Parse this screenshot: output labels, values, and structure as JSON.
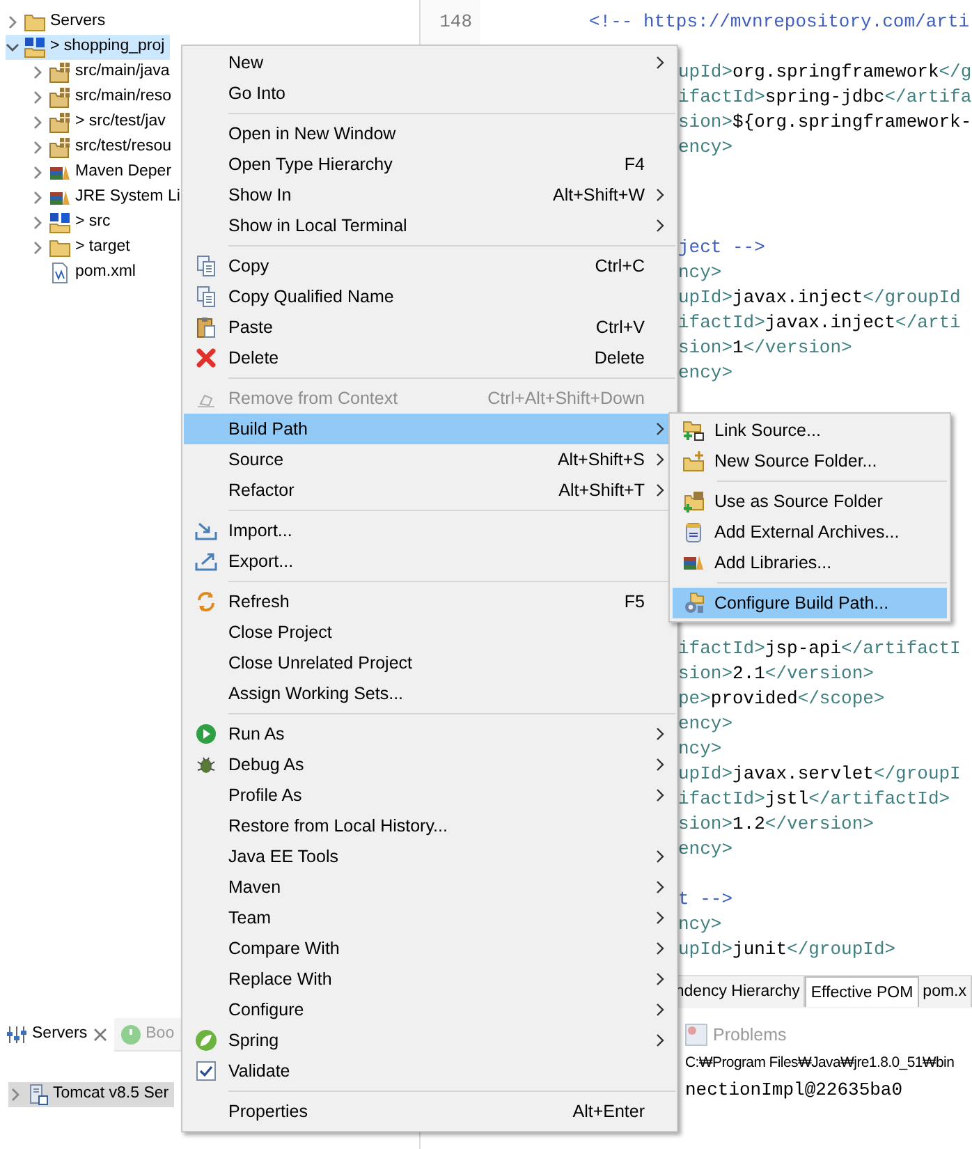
{
  "explorer": {
    "items": [
      {
        "label": "Servers",
        "expanded": false,
        "selected": false
      },
      {
        "label": "> shopping_proj",
        "expanded": true,
        "selected": true,
        "children": [
          {
            "label": "src/main/java",
            "expanded": false,
            "selected": false
          },
          {
            "label": "src/main/reso",
            "expanded": false,
            "selected": false
          },
          {
            "label": "> src/test/jav",
            "expanded": false,
            "selected": false
          },
          {
            "label": "src/test/resou",
            "expanded": false,
            "selected": false
          },
          {
            "label": "Maven Deper",
            "expanded": false,
            "selected": false
          },
          {
            "label": "JRE System Li",
            "expanded": false,
            "selected": false
          },
          {
            "label": "> src",
            "expanded": false,
            "selected": false
          },
          {
            "label": "> target",
            "expanded": false,
            "selected": false
          },
          {
            "label": "pom.xml",
            "selected": false
          }
        ]
      }
    ]
  },
  "servers_view": {
    "tabs": [
      {
        "label": "Servers",
        "selected": true
      },
      {
        "label": "Boo",
        "selected": false
      }
    ],
    "items": [
      {
        "label": "Tomcat v8.5 Ser",
        "expanded": false,
        "selected": true
      }
    ]
  },
  "editor": {
    "line_numbers": [
      "148"
    ],
    "lines": [
      {
        "segments": [
          {
            "text": "<!-- https://mvnrepository.com/arti",
            "kind": "comment"
          }
        ]
      },
      {
        "segments": [
          {
            "text": "upId>",
            "kind": "tag"
          },
          {
            "text": "org.springframework",
            "kind": "text"
          },
          {
            "text": "</g",
            "kind": "tag"
          }
        ]
      },
      {
        "segments": [
          {
            "text": "ifactId>",
            "kind": "tag"
          },
          {
            "text": "spring-jdbc",
            "kind": "text"
          },
          {
            "text": "</artifa",
            "kind": "tag"
          }
        ]
      },
      {
        "segments": [
          {
            "text": "sion>",
            "kind": "tag"
          },
          {
            "text": "${org.springframework-",
            "kind": "text"
          }
        ]
      },
      {
        "segments": [
          {
            "text": "ency>",
            "kind": "tag"
          }
        ]
      },
      {
        "segments": [
          {
            "text": "ject -->",
            "kind": "comment"
          }
        ]
      },
      {
        "segments": [
          {
            "text": "ncy>",
            "kind": "tag"
          }
        ]
      },
      {
        "segments": [
          {
            "text": "upId>",
            "kind": "tag"
          },
          {
            "text": "javax.inject",
            "kind": "text"
          },
          {
            "text": "</groupId",
            "kind": "tag"
          }
        ]
      },
      {
        "segments": [
          {
            "text": "ifactId>",
            "kind": "tag"
          },
          {
            "text": "javax.inject",
            "kind": "text"
          },
          {
            "text": "</arti",
            "kind": "tag"
          }
        ]
      },
      {
        "segments": [
          {
            "text": "sion>",
            "kind": "tag"
          },
          {
            "text": "1",
            "kind": "text"
          },
          {
            "text": "</version>",
            "kind": "tag"
          }
        ]
      },
      {
        "segments": [
          {
            "text": "ency>",
            "kind": "tag"
          }
        ]
      },
      {
        "segments": [
          {
            "text": "ifactId>",
            "kind": "tag"
          },
          {
            "text": "jsp-api",
            "kind": "text"
          },
          {
            "text": "</artifactI",
            "kind": "tag"
          }
        ]
      },
      {
        "segments": [
          {
            "text": "sion>",
            "kind": "tag"
          },
          {
            "text": "2.1",
            "kind": "text"
          },
          {
            "text": "</version>",
            "kind": "tag"
          }
        ]
      },
      {
        "segments": [
          {
            "text": "pe>",
            "kind": "tag"
          },
          {
            "text": "provided",
            "kind": "text"
          },
          {
            "text": "</scope>",
            "kind": "tag"
          }
        ]
      },
      {
        "segments": [
          {
            "text": "ency>",
            "kind": "tag"
          }
        ]
      },
      {
        "segments": [
          {
            "text": "ncy>",
            "kind": "tag"
          }
        ]
      },
      {
        "segments": [
          {
            "text": "upId>",
            "kind": "tag"
          },
          {
            "text": "javax.servlet",
            "kind": "text"
          },
          {
            "text": "</groupI",
            "kind": "tag"
          }
        ]
      },
      {
        "segments": [
          {
            "text": "ifactId>",
            "kind": "tag"
          },
          {
            "text": "jstl",
            "kind": "text"
          },
          {
            "text": "</artifactId>",
            "kind": "tag"
          }
        ]
      },
      {
        "segments": [
          {
            "text": "sion>",
            "kind": "tag"
          },
          {
            "text": "1.2",
            "kind": "text"
          },
          {
            "text": "</version>",
            "kind": "tag"
          }
        ]
      },
      {
        "segments": [
          {
            "text": "ency>",
            "kind": "tag"
          }
        ]
      },
      {
        "segments": [
          {
            "text": "t -->",
            "kind": "comment"
          }
        ]
      },
      {
        "segments": [
          {
            "text": "ncy>",
            "kind": "tag"
          }
        ]
      },
      {
        "segments": [
          {
            "text": "upId>",
            "kind": "tag"
          },
          {
            "text": "junit",
            "kind": "text"
          },
          {
            "text": "</groupId>",
            "kind": "tag"
          }
        ]
      }
    ]
  },
  "editor_tabs": [
    {
      "label": "ndency Hierarchy",
      "selected": false
    },
    {
      "label": "Effective POM",
      "selected": true
    },
    {
      "label": "pom.x",
      "selected": false
    }
  ],
  "console": {
    "tab": "Problems",
    "lines": [
      "C:₩Program Files₩Java₩jre1.8.0_51₩bin",
      "nectionImpl@22635ba0"
    ]
  },
  "context_menu": {
    "items": [
      {
        "kind": "command",
        "label": "New",
        "submenu": true,
        "disabled": false,
        "selected": false
      },
      {
        "kind": "command",
        "label": "Go Into",
        "submenu": false,
        "disabled": false,
        "selected": false
      },
      {
        "kind": "separator"
      },
      {
        "kind": "command",
        "label": "Open in New Window",
        "submenu": false,
        "disabled": false,
        "selected": false
      },
      {
        "kind": "command",
        "label": "Open Type Hierarchy",
        "shortcut": "F4",
        "submenu": false,
        "disabled": false,
        "selected": false
      },
      {
        "kind": "command",
        "label": "Show In",
        "shortcut": "Alt+Shift+W",
        "submenu": true,
        "disabled": false,
        "selected": false
      },
      {
        "kind": "command",
        "label": "Show in Local Terminal",
        "submenu": true,
        "disabled": false,
        "selected": false
      },
      {
        "kind": "separator"
      },
      {
        "kind": "command",
        "label": "Copy",
        "shortcut": "Ctrl+C",
        "submenu": false,
        "disabled": false,
        "selected": false
      },
      {
        "kind": "command",
        "label": "Copy Qualified Name",
        "submenu": false,
        "disabled": false,
        "selected": false
      },
      {
        "kind": "command",
        "label": "Paste",
        "shortcut": "Ctrl+V",
        "submenu": false,
        "disabled": false,
        "selected": false
      },
      {
        "kind": "command",
        "label": "Delete",
        "shortcut": "Delete",
        "submenu": false,
        "disabled": false,
        "selected": false
      },
      {
        "kind": "separator"
      },
      {
        "kind": "command",
        "label": "Remove from Context",
        "shortcut": "Ctrl+Alt+Shift+Down",
        "submenu": false,
        "disabled": true,
        "selected": false
      },
      {
        "kind": "command",
        "label": "Build Path",
        "submenu": true,
        "disabled": false,
        "selected": true
      },
      {
        "kind": "command",
        "label": "Source",
        "shortcut": "Alt+Shift+S",
        "submenu": true,
        "disabled": false,
        "selected": false
      },
      {
        "kind": "command",
        "label": "Refactor",
        "shortcut": "Alt+Shift+T",
        "submenu": true,
        "disabled": false,
        "selected": false
      },
      {
        "kind": "separator"
      },
      {
        "kind": "command",
        "label": "Import...",
        "submenu": false,
        "disabled": false,
        "selected": false
      },
      {
        "kind": "command",
        "label": "Export...",
        "submenu": false,
        "disabled": false,
        "selected": false
      },
      {
        "kind": "separator"
      },
      {
        "kind": "command",
        "label": "Refresh",
        "shortcut": "F5",
        "submenu": false,
        "disabled": false,
        "selected": false
      },
      {
        "kind": "command",
        "label": "Close Project",
        "submenu": false,
        "disabled": false,
        "selected": false
      },
      {
        "kind": "command",
        "label": "Close Unrelated Project",
        "submenu": false,
        "disabled": false,
        "selected": false
      },
      {
        "kind": "command",
        "label": "Assign Working Sets...",
        "submenu": false,
        "disabled": false,
        "selected": false
      },
      {
        "kind": "separator"
      },
      {
        "kind": "command",
        "label": "Run As",
        "submenu": true,
        "disabled": false,
        "selected": false
      },
      {
        "kind": "command",
        "label": "Debug As",
        "submenu": true,
        "disabled": false,
        "selected": false
      },
      {
        "kind": "command",
        "label": "Profile As",
        "submenu": true,
        "disabled": false,
        "selected": false
      },
      {
        "kind": "command",
        "label": "Restore from Local History...",
        "submenu": false,
        "disabled": false,
        "selected": false
      },
      {
        "kind": "command",
        "label": "Java EE Tools",
        "submenu": true,
        "disabled": false,
        "selected": false
      },
      {
        "kind": "command",
        "label": "Maven",
        "submenu": true,
        "disabled": false,
        "selected": false
      },
      {
        "kind": "command",
        "label": "Team",
        "submenu": true,
        "disabled": false,
        "selected": false
      },
      {
        "kind": "command",
        "label": "Compare With",
        "submenu": true,
        "disabled": false,
        "selected": false
      },
      {
        "kind": "command",
        "label": "Replace With",
        "submenu": true,
        "disabled": false,
        "selected": false
      },
      {
        "kind": "command",
        "label": "Configure",
        "submenu": true,
        "disabled": false,
        "selected": false
      },
      {
        "kind": "command",
        "label": "Spring",
        "submenu": true,
        "disabled": false,
        "selected": false
      },
      {
        "kind": "check",
        "label": "Validate",
        "checked": true,
        "submenu": false,
        "disabled": false,
        "selected": false
      },
      {
        "kind": "separator"
      },
      {
        "kind": "command",
        "label": "Properties",
        "shortcut": "Alt+Enter",
        "submenu": false,
        "disabled": false,
        "selected": false
      }
    ]
  },
  "submenu": {
    "items": [
      {
        "kind": "command",
        "label": "Link Source...",
        "selected": false
      },
      {
        "kind": "command",
        "label": "New Source Folder...",
        "selected": false
      },
      {
        "kind": "separator"
      },
      {
        "kind": "command",
        "label": "Use as Source Folder",
        "selected": false
      },
      {
        "kind": "command",
        "label": "Add External Archives...",
        "selected": false
      },
      {
        "kind": "command",
        "label": "Add Libraries...",
        "selected": false
      },
      {
        "kind": "separator"
      },
      {
        "kind": "command",
        "label": "Configure Build Path...",
        "selected": true
      }
    ]
  }
}
